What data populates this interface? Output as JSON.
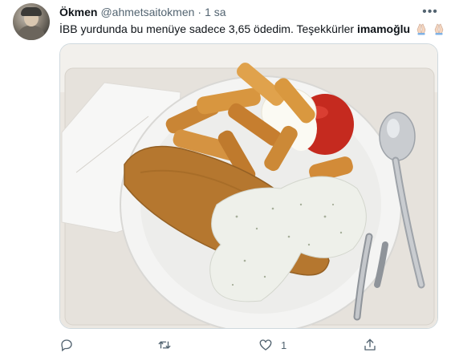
{
  "tweet": {
    "display_name": "Ökmen",
    "handle": "@ahmetsaitokmen",
    "separator": "·",
    "time": "1 sa",
    "more_label": "•••",
    "text_main": "İBB yurdunda bu menüye sadece 3,65 ödedim. Teşekkürler ",
    "text_mention": "imamoğlu",
    "emoji": "praying-hands-emoji"
  },
  "media": {
    "description_icon": "photo"
  },
  "actions": {
    "reply": {
      "icon": "reply-icon",
      "count": ""
    },
    "retweet": {
      "icon": "retweet-icon",
      "count": ""
    },
    "like": {
      "icon": "heart-icon",
      "count": "1"
    },
    "share": {
      "icon": "share-icon",
      "count": ""
    }
  },
  "colors": {
    "text_primary": "#0f1419",
    "text_secondary": "#536471",
    "border": "#cfd9de"
  }
}
